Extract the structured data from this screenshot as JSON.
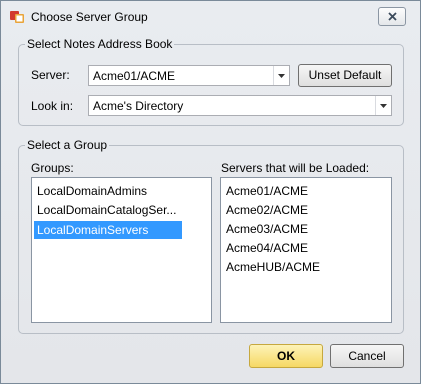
{
  "window": {
    "title": "Choose Server Group",
    "app_icon": "notes-app-icon",
    "close_icon": "close-icon"
  },
  "address_book": {
    "legend": "Select Notes Address Book",
    "server_label": "Server:",
    "server_value": "Acme01/ACME",
    "unset_default_label": "Unset Default",
    "lookin_label": "Look in:",
    "lookin_value": "Acme's Directory"
  },
  "group_select": {
    "legend": "Select a Group",
    "groups_label": "Groups:",
    "servers_label": "Servers that will be Loaded:",
    "groups": [
      {
        "label": "LocalDomainAdmins",
        "selected": false
      },
      {
        "label": "LocalDomainCatalogSer...",
        "selected": false
      },
      {
        "label": "LocalDomainServers",
        "selected": true
      }
    ],
    "servers": [
      "Acme01/ACME",
      "Acme02/ACME",
      "Acme03/ACME",
      "Acme04/ACME",
      "AcmeHUB/ACME"
    ]
  },
  "buttons": {
    "ok_label": "OK",
    "cancel_label": "Cancel"
  },
  "colors": {
    "selection": "#3399ff",
    "ok_button": "#f6d864"
  }
}
